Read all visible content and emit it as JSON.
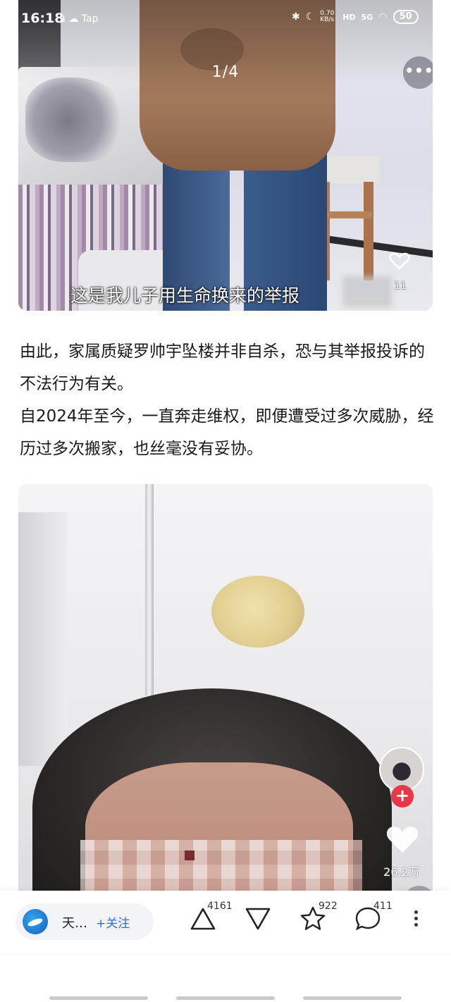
{
  "status_bar": {
    "time": "16:18",
    "left_icons": "⭳ ☁ Tap",
    "net_speed": "0.70 KB/s",
    "hd": "HD",
    "signal": "5G",
    "battery": "50"
  },
  "post_card_1": {
    "page_indicator": "1/4",
    "more_label": "•••",
    "subtitle": "这是我儿子用生命换来的举报",
    "like_count": "11"
  },
  "body_text": {
    "paragraphs": [
      "由此，家属质疑罗帅宇坠楼并非自杀，恐与其举报投诉的不法行为有关。",
      "自2024年至今，一直奔走维权，即便遭受过多次威胁，经历过多次搬家，也丝毫没有妥协。"
    ]
  },
  "video_card_2": {
    "plus_label": "+",
    "like_count": "26.2万",
    "download_label": "⭳"
  },
  "bottom_bar": {
    "author_name": "天…",
    "follow_label": "+关注",
    "upvote_count": "4161",
    "favorite_count": "922",
    "comment_count": "411",
    "more_label": "⋮"
  },
  "icons": {
    "upvote": "upvote-triangle-icon",
    "downvote": "downvote-triangle-icon",
    "favorite": "star-icon",
    "comment": "comment-bubble-icon",
    "more": "vertical-dots-icon",
    "download": "download-icon",
    "like": "heart-icon"
  }
}
